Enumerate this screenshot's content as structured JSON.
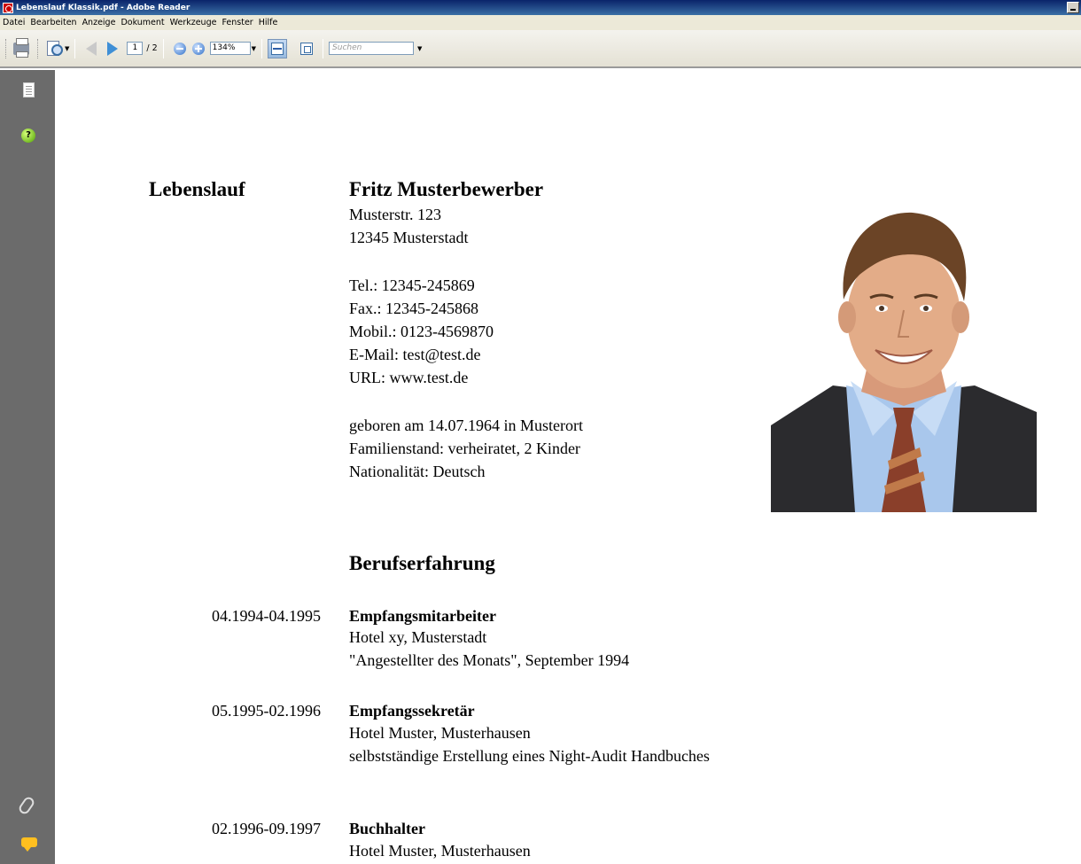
{
  "window": {
    "title": "Lebenslauf Klassik.pdf - Adobe Reader"
  },
  "menu": [
    "Datei",
    "Bearbeiten",
    "Anzeige",
    "Dokument",
    "Werkzeuge",
    "Fenster",
    "Hilfe"
  ],
  "toolbar": {
    "page_current": "1",
    "page_total": "/ 2",
    "zoom": "134%",
    "search_placeholder": "Suchen"
  },
  "icons": [
    "print-icon",
    "search-document-icon",
    "previous-page-icon",
    "next-page-icon",
    "zoom-out-icon",
    "zoom-in-icon",
    "fit-page-icon",
    "fit-width-icon",
    "pages-icon",
    "help-icon",
    "attachment-icon",
    "comments-icon"
  ],
  "document": {
    "heading": "Lebenslauf",
    "name": "Fritz Musterbewerber",
    "address": [
      "Musterstr. 123",
      "12345 Musterstadt"
    ],
    "contact": [
      "Tel.: 12345-245869",
      "Fax.: 12345-245868",
      "Mobil.: 0123-4569870",
      "E-Mail: test@test.de",
      "URL: www.test.de"
    ],
    "personal": [
      "geboren am 14.07.1964 in Musterort",
      "Familienstand: verheiratet, 2 Kinder",
      "Nationalität: Deutsch"
    ],
    "section_title": "Berufserfahrung",
    "experience": [
      {
        "dates": "04.1994-04.1995",
        "title": "Empfangsmitarbeiter",
        "details": [
          "Hotel xy, Musterstadt",
          "\"Angestellter des Monats\", September 1994"
        ]
      },
      {
        "dates": "05.1995-02.1996",
        "title": "Empfangssekretär",
        "details": [
          "Hotel Muster, Musterhausen",
          "selbstständige Erstellung eines Night-Audit Handbuches"
        ]
      },
      {
        "dates": "02.1996-09.1997",
        "title": "Buchhalter",
        "details": [
          "Hotel Muster, Musterhausen"
        ]
      }
    ]
  }
}
